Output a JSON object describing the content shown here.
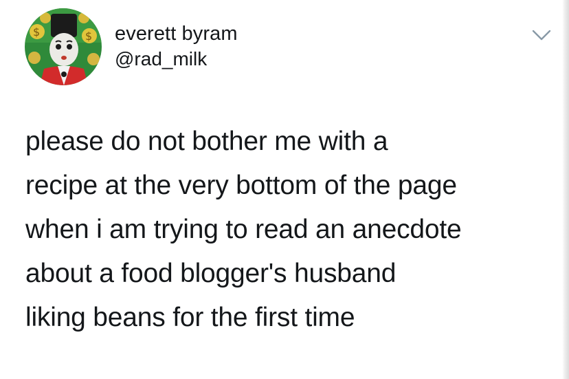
{
  "user": {
    "display_name": "everett byram",
    "handle": "@rad_milk",
    "avatar_icon": "user-avatar-icon"
  },
  "menu": {
    "icon": "chevron-down-icon"
  },
  "tweet": {
    "lines": [
      "please do not bother me with a",
      "recipe at the very bottom of the page",
      "when i am trying to read an anecdote",
      "about a food blogger's husband",
      "liking beans for the first time"
    ]
  },
  "colors": {
    "text": "#14171a",
    "chevron": "#8899a6",
    "background": "#ffffff"
  }
}
